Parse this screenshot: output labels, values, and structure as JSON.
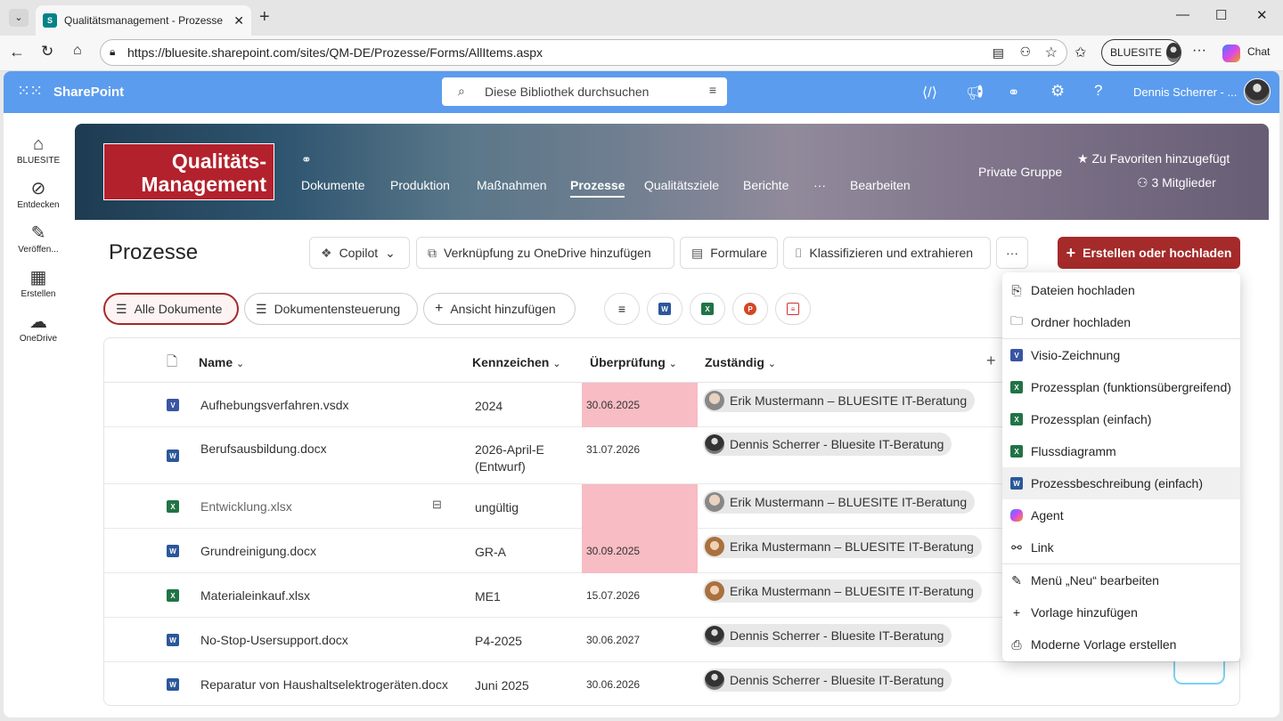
{
  "browser": {
    "tab_title": "Qualitätsmanagement - Prozesse",
    "url": "https://bluesite.sharepoint.com/sites/QM-DE/Prozesse/Forms/AllItems.aspx",
    "profile": "BLUESITE",
    "chat": "Chat"
  },
  "suite": {
    "app": "SharePoint",
    "search_placeholder": "Diese Bibliothek durchsuchen",
    "user": "Dennis Scherrer - ..."
  },
  "rail": [
    {
      "label": "BLUESITE",
      "icon": "home-icon"
    },
    {
      "label": "Entdecken",
      "icon": "discover-icon"
    },
    {
      "label": "Veröffen...",
      "icon": "publish-icon"
    },
    {
      "label": "Erstellen",
      "icon": "create-icon"
    },
    {
      "label": "OneDrive",
      "icon": "cloud-icon"
    }
  ],
  "site": {
    "logo_line1": "Qualitäts-",
    "logo_line2": "Management",
    "nav": [
      "Dokumente",
      "Produktion",
      "Maßnahmen",
      "Prozesse",
      "Qualitätsziele",
      "Berichte",
      "···",
      "Bearbeiten"
    ],
    "privacy": "Private Gruppe",
    "favorite": "Zu Favoriten hinzugefügt",
    "members": "3 Mitglieder"
  },
  "library": {
    "title": "Prozesse",
    "copilot": "Copilot",
    "onedrive": "Verknüpfung zu OneDrive hinzufügen",
    "forms": "Formulare",
    "classify": "Klassifizieren und extrahieren",
    "create": "Erstellen oder hochladen"
  },
  "views": {
    "all": "Alle Dokumente",
    "control": "Dokumentensteuerung",
    "add": "Ansicht hinzufügen"
  },
  "columns": {
    "name": "Name",
    "code": "Kennzeichen",
    "review": "Überprüfung",
    "owner": "Zuständig"
  },
  "rows": [
    {
      "name": "Aufhebungsverfahren.vsdx",
      "type": "visio",
      "code": "2024",
      "review": "30.06.2025",
      "overdue": true,
      "owner": "Erik Mustermann – BLUESITE IT-Beratung"
    },
    {
      "name": "Berufsausbildung.docx",
      "type": "word",
      "code": "2026-April-E (Entwurf)",
      "review": "31.07.2026",
      "overdue": false,
      "owner": "Dennis Scherrer - Bluesite IT-Beratung"
    },
    {
      "name": "Entwicklung.xlsx",
      "type": "excel",
      "code": "ungültig",
      "review": "",
      "overdue": true,
      "owner": "Erik Mustermann – BLUESITE IT-Beratung"
    },
    {
      "name": "Grundreinigung.docx",
      "type": "word",
      "code": "GR-A",
      "review": "30.09.2025",
      "overdue": true,
      "owner": "Erika Mustermann – BLUESITE IT-Beratung"
    },
    {
      "name": "Materialeinkauf.xlsx",
      "type": "excel",
      "code": "ME1",
      "review": "15.07.2026",
      "overdue": false,
      "owner": "Erika Mustermann – BLUESITE IT-Beratung"
    },
    {
      "name": "No-Stop-Usersupport.docx",
      "type": "word",
      "code": "P4-2025",
      "review": "30.06.2027",
      "overdue": false,
      "owner": "Dennis Scherrer - Bluesite IT-Beratung"
    },
    {
      "name": "Reparatur von Haushaltselektrogeräten.docx",
      "type": "word",
      "code": "Juni 2025",
      "review": "30.06.2026",
      "overdue": false,
      "owner": "Dennis Scherrer - Bluesite IT-Beratung"
    }
  ],
  "menu": [
    "Dateien hochladen",
    "Ordner hochladen",
    "Visio-Zeichnung",
    "Prozessplan (funktionsübergreifend)",
    "Prozessplan (einfach)",
    "Flussdiagramm",
    "Prozessbeschreibung (einfach)",
    "Agent",
    "Link",
    "Menü „Neu“ bearbeiten",
    "Vorlage hinzufügen",
    "Moderne Vorlage erstellen"
  ],
  "colors": {
    "suite": "#5b9cee",
    "create": "#a52a2a",
    "overdue": "#f8bcc4",
    "word": "#2b579a",
    "excel": "#217346",
    "visio": "#3955a3"
  }
}
